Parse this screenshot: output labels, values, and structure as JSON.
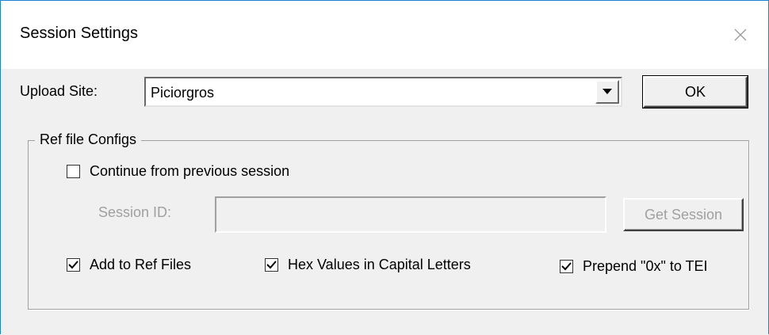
{
  "window": {
    "title": "Session Settings",
    "close_glyph": "✕"
  },
  "upload": {
    "label": "Upload Site:",
    "value": "Piciorgros",
    "arrow_glyph": "▼"
  },
  "buttons": {
    "ok": "OK",
    "get_session": "Get Session"
  },
  "group": {
    "legend": "Ref file Configs",
    "continue_label": "Continue from  previous session",
    "continue_checked": false,
    "session_id_label": "Session ID:",
    "session_id_value": "",
    "options": [
      {
        "label": "Add to Ref Files",
        "checked": true
      },
      {
        "label": "Hex Values in Capital Letters",
        "checked": true
      },
      {
        "label": "Prepend  \"0x\" to TEI",
        "checked": true
      }
    ]
  },
  "icons": {
    "close": "close-icon",
    "dropdown": "chevron-down-icon",
    "check": "checkmark-icon"
  },
  "colors": {
    "window_border": "#1883d7",
    "face": "#f0f0f0",
    "disabled_text": "#a0a0a0"
  }
}
